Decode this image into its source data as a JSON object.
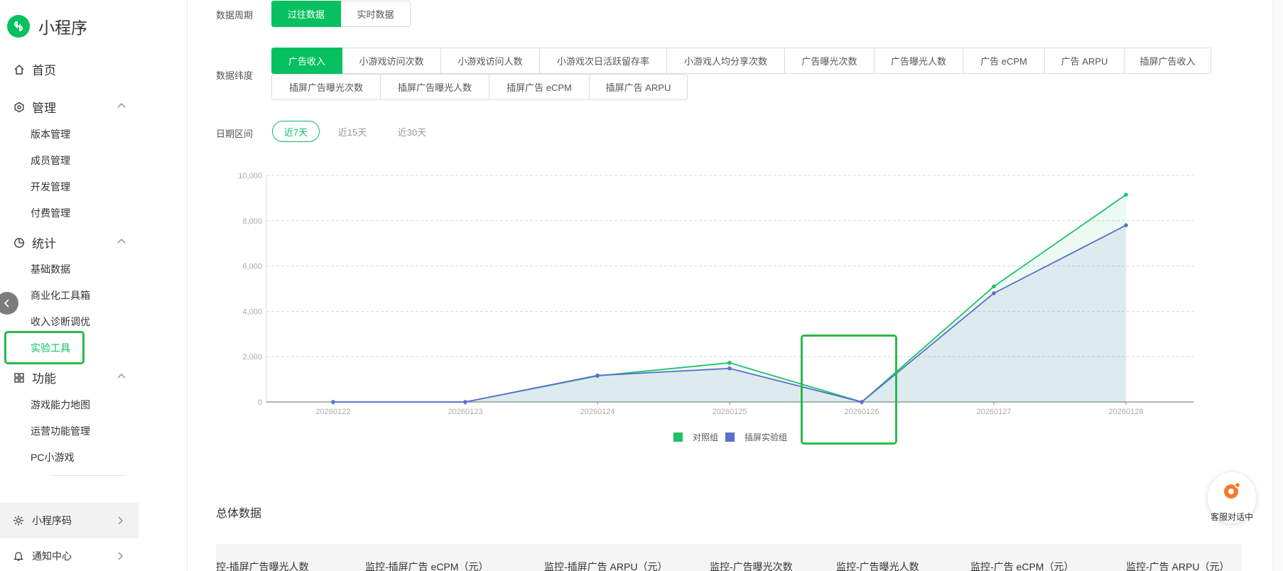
{
  "app": {
    "name": "小程序"
  },
  "sidebar": {
    "home_label": "首页",
    "groups": [
      {
        "label": "管理",
        "items": [
          "版本管理",
          "成员管理",
          "开发管理",
          "付费管理"
        ]
      },
      {
        "label": "统计",
        "items": [
          "基础数据",
          "商业化工具箱",
          "收入诊断调优",
          "实验工具"
        ]
      },
      {
        "label": "功能",
        "items": [
          "游戏能力地图",
          "运营功能管理",
          "PC小游戏"
        ]
      }
    ],
    "active_item": "实验工具",
    "mini_code_label": "小程序码",
    "notice_label": "通知中心"
  },
  "filters": {
    "period_label": "数据周期",
    "period_options": [
      "过往数据",
      "实时数据"
    ],
    "period_selected": "过往数据",
    "dimension_label": "数据纬度",
    "dimension_row1": [
      "广告收入",
      "小游戏访问次数",
      "小游戏访问人数",
      "小游戏次日活跃留存率",
      "小游戏人均分享次数",
      "广告曝光次数",
      "广告曝光人数",
      "广告 eCPM",
      "广告 ARPU",
      "插屏广告收入"
    ],
    "dimension_row2": [
      "插屏广告曝光次数",
      "插屏广告曝光人数",
      "插屏广告 eCPM",
      "插屏广告 ARPU"
    ],
    "dimension_selected": "广告收入",
    "date_label": "日期区间",
    "date_options": [
      "近7天",
      "近15天",
      "近30天"
    ],
    "date_selected": "近7天"
  },
  "colors": {
    "accent": "#07c160",
    "series_control": "#1fc06a",
    "series_experiment": "#5b6fcd",
    "highlight_box": "#2db84d"
  },
  "chart_data": {
    "type": "line",
    "x": [
      "20260122",
      "20260123",
      "20260124",
      "20260125",
      "20260126",
      "20260127",
      "20260128"
    ],
    "series": [
      {
        "name": "对照组",
        "values": [
          0,
          0,
          1150,
          1730,
          0,
          5100,
          9150
        ]
      },
      {
        "name": "插屏实验组",
        "values": [
          0,
          0,
          1170,
          1480,
          0,
          4800,
          7800
        ]
      }
    ],
    "yticks": [
      "10,000",
      "8,000",
      "6,000",
      "4,000",
      "2,000",
      "0"
    ],
    "ylim": [
      0,
      10000
    ],
    "grid": true,
    "legend_position": "bottom-center"
  },
  "overall": {
    "title": "总体数据",
    "columns": [
      "控-插屏广告曝光人数",
      "监控-插屏广告 eCPM（元）",
      "监控-插屏广告 ARPU（元）",
      "监控-广告曝光次数",
      "监控-广告曝光人数",
      "监控-广告 eCPM（元）",
      "监控-广告 ARPU（元）"
    ]
  },
  "service": {
    "label": "客服对话中"
  }
}
